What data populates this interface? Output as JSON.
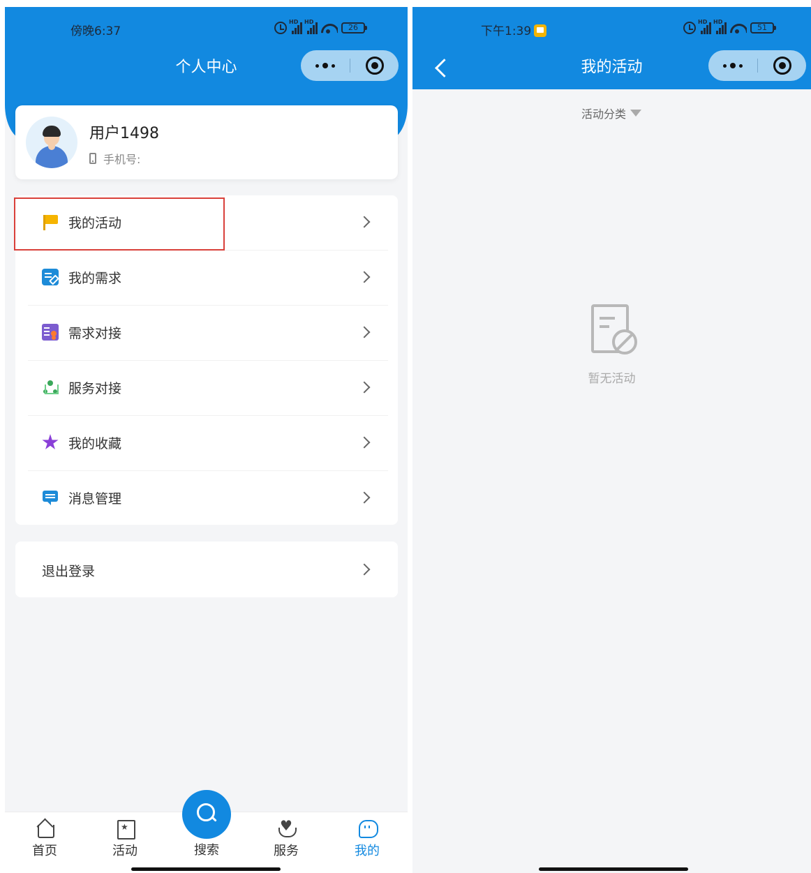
{
  "left_screen": {
    "status": {
      "time": "傍晚6:37",
      "battery": "26"
    },
    "title": "个人中心",
    "profile": {
      "user_name": "用户1498",
      "phone_label": "手机号:"
    },
    "menu": [
      {
        "label": "我的活动",
        "icon": "flag-icon"
      },
      {
        "label": "我的需求",
        "icon": "edit-doc-icon"
      },
      {
        "label": "需求对接",
        "icon": "match-doc-icon"
      },
      {
        "label": "服务对接",
        "icon": "network-icon"
      },
      {
        "label": "我的收藏",
        "icon": "star-icon"
      },
      {
        "label": "消息管理",
        "icon": "message-icon"
      }
    ],
    "logout_label": "退出登录",
    "tabs": [
      {
        "label": "首页",
        "icon": "home-icon"
      },
      {
        "label": "活动",
        "icon": "activity-icon"
      },
      {
        "label": "搜索",
        "icon": "search-icon"
      },
      {
        "label": "服务",
        "icon": "heart-hand-icon"
      },
      {
        "label": "我的",
        "icon": "profile-icon",
        "active": true
      }
    ]
  },
  "right_screen": {
    "status": {
      "time": "下午1:39",
      "battery": "51"
    },
    "title": "我的活动",
    "filter_label": "活动分类",
    "empty_text": "暂无活动"
  },
  "colors": {
    "brand": "#1289e0",
    "highlight": "#d9403a",
    "active_tab": "#1289e0"
  }
}
